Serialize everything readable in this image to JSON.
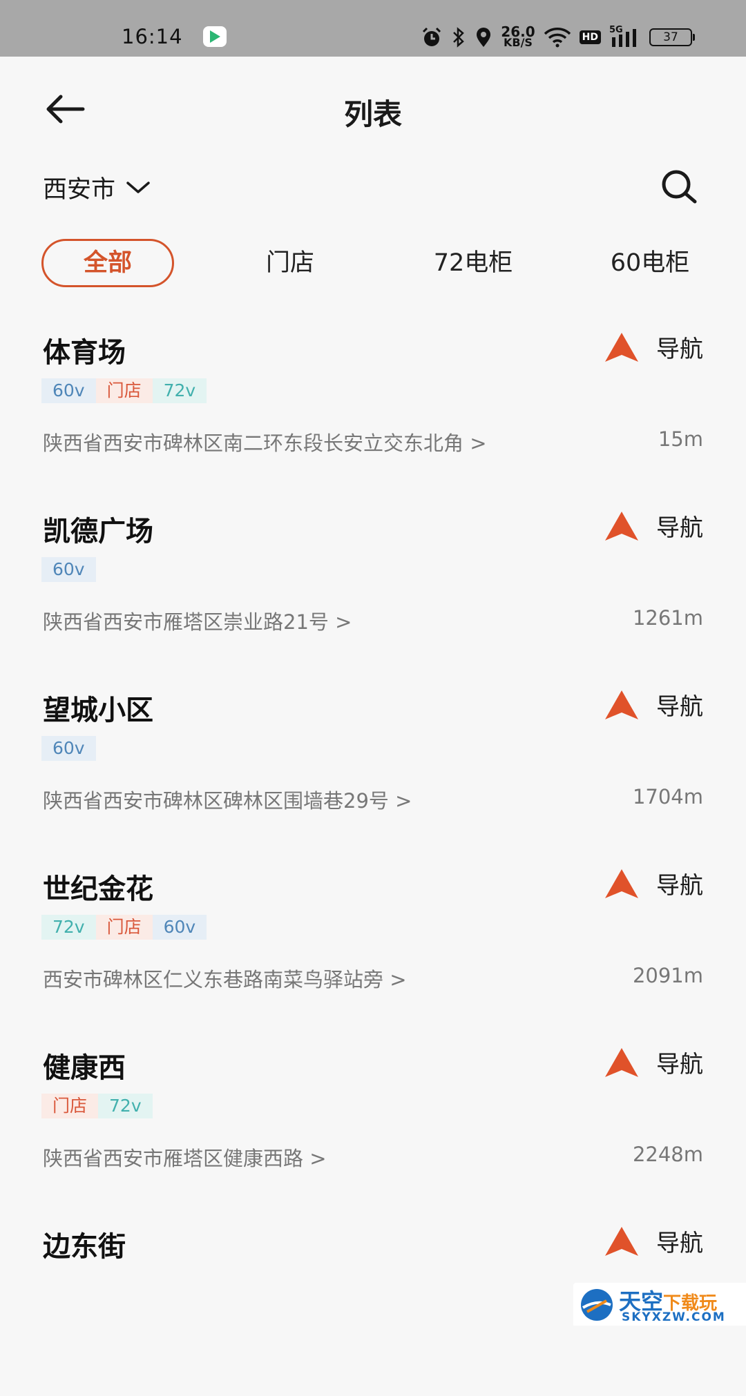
{
  "status_bar": {
    "time": "16:14",
    "speed_value": "26.0",
    "speed_unit": "KB/S",
    "hd": "HD",
    "network": "5G",
    "battery": "37"
  },
  "header": {
    "title": "列表"
  },
  "city": {
    "name": "西安市"
  },
  "tabs": [
    {
      "label": "全部",
      "active": true
    },
    {
      "label": "门店",
      "active": false
    },
    {
      "label": "72电柜",
      "active": false
    },
    {
      "label": "60电柜",
      "active": false
    }
  ],
  "nav_label": "导航",
  "colors": {
    "accent": "#d4542b",
    "tag_60": "#4f86b8",
    "tag_72": "#41b0ad",
    "tag_store": "#d9573a"
  },
  "stations": [
    {
      "name": "体育场",
      "tags": [
        "60v",
        "门店",
        "72v"
      ],
      "address": "陕西省西安市碑林区南二环东段长安立交东北角 >",
      "distance": "15m"
    },
    {
      "name": "凯德广场",
      "tags": [
        "60v"
      ],
      "address": "陕西省西安市雁塔区崇业路21号 >",
      "distance": "1261m"
    },
    {
      "name": "望城小区",
      "tags": [
        "60v"
      ],
      "address": "陕西省西安市碑林区碑林区围墙巷29号 >",
      "distance": "1704m"
    },
    {
      "name": "世纪金花",
      "tags": [
        "72v",
        "门店",
        "60v"
      ],
      "address": "西安市碑林区仁义东巷路南菜鸟驿站旁 >",
      "distance": "2091m"
    },
    {
      "name": "健康西",
      "tags": [
        "门店",
        "72v"
      ],
      "address": "陕西省西安市雁塔区健康西路 >",
      "distance": "2248m"
    },
    {
      "name": "边东街",
      "tags": [],
      "address": "",
      "distance": ""
    }
  ],
  "watermark": {
    "cn_main": "天空",
    "cn_accent": "下载玩",
    "en": "SKYXZW.COM"
  }
}
